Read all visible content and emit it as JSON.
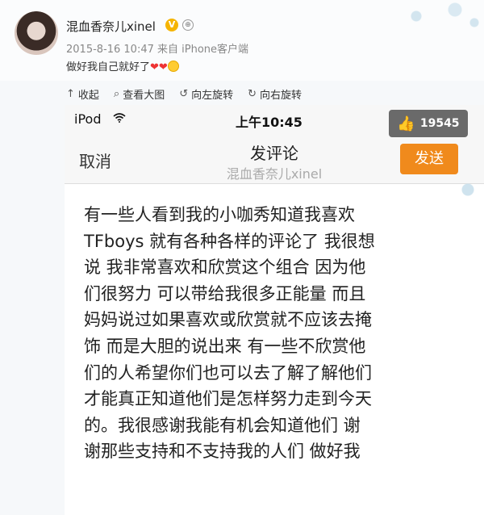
{
  "post": {
    "username": "混血香奈儿xinel",
    "meta": "2015-8-16 10:47 来自 iPhone客户端",
    "text": "做好我自己就好了",
    "hearts": "❤❤"
  },
  "toolbar": {
    "collapse": "收起",
    "view_large": "查看大图",
    "rotate_left": "向左旋转",
    "rotate_right": "向右旋转"
  },
  "phone": {
    "carrier": "iPod",
    "time": "上午10:45",
    "like_count": "19545",
    "cancel": "取消",
    "title": "发评论",
    "subtitle": "混血香奈儿xinel",
    "send": "发送",
    "comment_lines": [
      "有一些人看到我的小咖秀知道我喜欢",
      "TFboys 就有各种各样的评论了 我很想",
      "说 我非常喜欢和欣赏这个组合 因为他",
      "们很努力 可以带给我很多正能量 而且",
      "妈妈说过如果喜欢或欣赏就不应该去掩",
      "饰 而是大胆的说出来 有一些不欣赏他",
      "们的人希望你们也可以去了解了解他们",
      "才能真正知道他们是怎样努力走到今天",
      "的。我很感谢我能有机会知道他们 谢",
      "谢那些支持和不支持我的人们 做好我"
    ]
  }
}
